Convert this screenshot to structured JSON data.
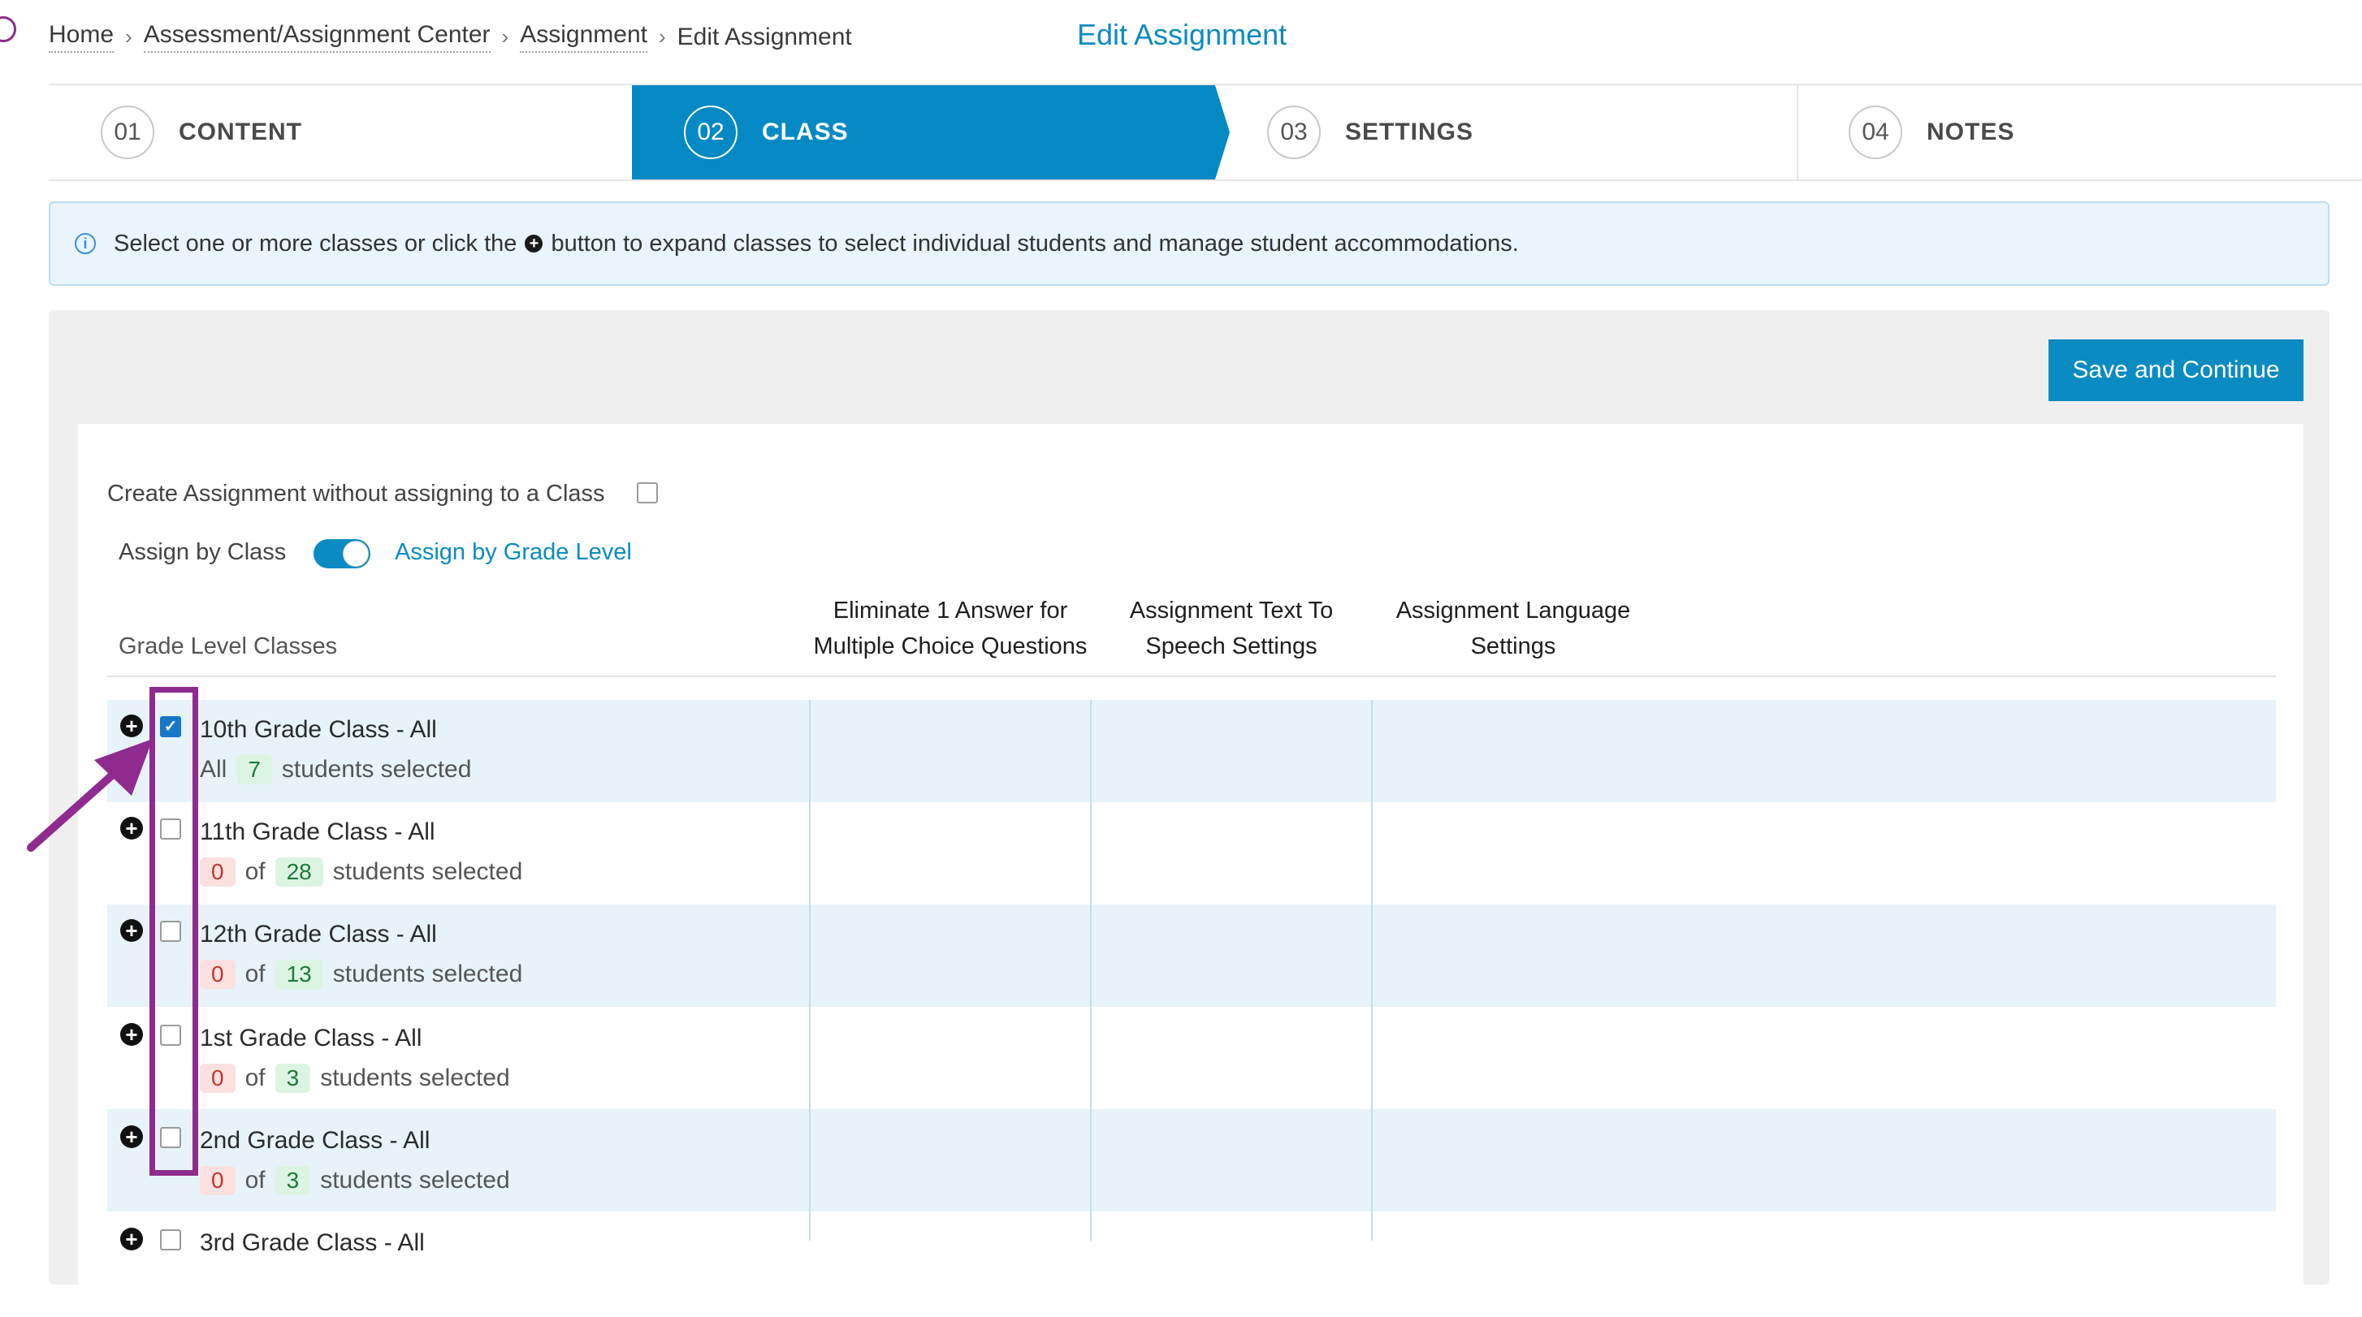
{
  "breadcrumb": [
    {
      "label": "Home",
      "link": true
    },
    {
      "label": "Assessment/Assignment Center",
      "link": true
    },
    {
      "label": "Assignment",
      "link": true
    },
    {
      "label": "Edit Assignment",
      "link": false
    }
  ],
  "page_title": "Edit Assignment",
  "steps": [
    {
      "num": "01",
      "label": "CONTENT",
      "active": false
    },
    {
      "num": "02",
      "label": "CLASS",
      "active": true
    },
    {
      "num": "03",
      "label": "SETTINGS",
      "active": false
    },
    {
      "num": "04",
      "label": "NOTES",
      "active": false
    }
  ],
  "info": {
    "text_before": "Select one or more classes or click the",
    "text_after": "button to expand classes to select individual students and manage student accommodations."
  },
  "save_button": "Save and Continue",
  "no_class_option": {
    "label": "Create Assignment without assigning to a Class",
    "checked": false
  },
  "assign_toggle": {
    "left_label": "Assign by Class",
    "right_label": "Assign by Grade Level",
    "on": true
  },
  "table": {
    "headers": {
      "classes": "Grade Level Classes",
      "eliminate": [
        "Eliminate 1 Answer for",
        "Multiple Choice Questions"
      ],
      "tts": [
        "Assignment Text To",
        "Speech Settings"
      ],
      "language": [
        "Assignment Language",
        "Settings"
      ]
    },
    "rows": [
      {
        "title": "10th Grade Class - All",
        "checked": true,
        "all": true,
        "prefix": "All",
        "selected": "7",
        "suffix": "students selected"
      },
      {
        "title": "11th Grade Class - All",
        "checked": false,
        "all": false,
        "selected": "0",
        "of": "of",
        "total": "28",
        "suffix": "students selected"
      },
      {
        "title": "12th Grade Class - All",
        "checked": false,
        "all": false,
        "selected": "0",
        "of": "of",
        "total": "13",
        "suffix": "students selected"
      },
      {
        "title": "1st Grade Class - All",
        "checked": false,
        "all": false,
        "selected": "0",
        "of": "of",
        "total": "3",
        "suffix": "students selected"
      },
      {
        "title": "2nd Grade Class - All",
        "checked": false,
        "all": false,
        "selected": "0",
        "of": "of",
        "total": "3",
        "suffix": "students selected"
      },
      {
        "title": "3rd Grade Class - All",
        "checked": false,
        "all": false
      }
    ]
  },
  "colors": {
    "accent": "#0a8bc1",
    "highlight": "#8f2a8f",
    "shaded_row": "#e7f3f8"
  }
}
